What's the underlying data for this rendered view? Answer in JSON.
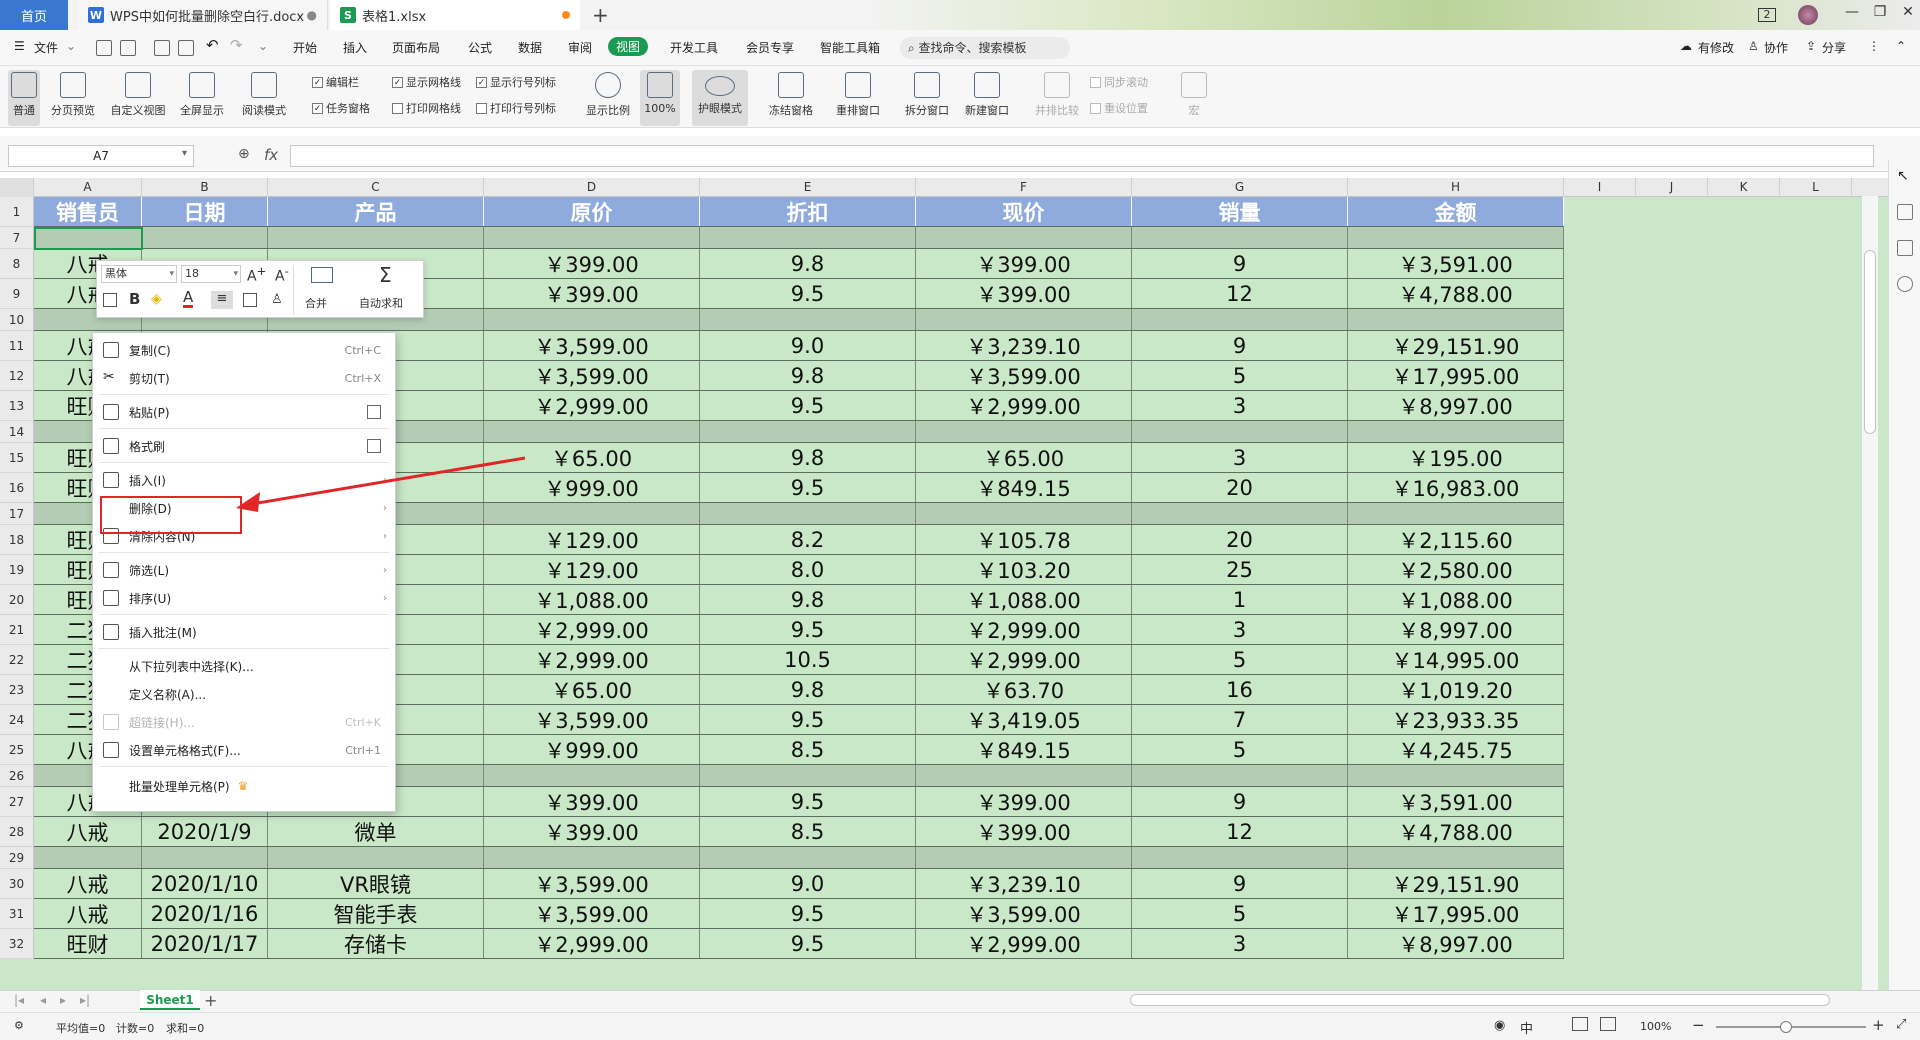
{
  "tabs": {
    "home": "首页",
    "doc": "WPS中如何批量删除空白行.docx",
    "xls": "表格1.xlsx",
    "badge": "2"
  },
  "menu": {
    "file": "文件",
    "items": [
      "开始",
      "插入",
      "页面布局",
      "公式",
      "数据",
      "审阅",
      "视图",
      "开发工具",
      "会员专享",
      "智能工具箱"
    ],
    "active": "视图",
    "search": "查找命令、搜索模板",
    "modify": "有修改",
    "collab": "协作",
    "share": "分享"
  },
  "ribbon": {
    "normal": "普通",
    "pagebreak": "分页预览",
    "custom": "自定义视图",
    "fullscreen": "全屏显示",
    "reading": "阅读模式",
    "cb_editbar": "编辑栏",
    "cb_taskpane": "任务窗格",
    "cb_showgrid": "显示网格线",
    "cb_printgrid": "打印网格线",
    "cb_showheaders": "显示行号列标",
    "cb_printheaders": "打印行号列标",
    "ratio": "显示比例",
    "p100": "100%",
    "eyecare": "护眼模式",
    "freeze": "冻结窗格",
    "rearrange": "重排窗口",
    "split": "拆分窗口",
    "newwin": "新建窗口",
    "compare": "并排比较",
    "sync": "同步滚动",
    "resetpos": "重设位置",
    "macro": "宏"
  },
  "formula": {
    "namebox": "A7",
    "fx": "fx",
    "value": ""
  },
  "columns": [
    "A",
    "B",
    "C",
    "D",
    "E",
    "F",
    "G",
    "H",
    "I",
    "J",
    "K",
    "L"
  ],
  "header_row": {
    "num": "1",
    "cells": [
      "销售员",
      "日期",
      "产品",
      "原价",
      "折扣",
      "现价",
      "销量",
      "金额"
    ]
  },
  "rows": [
    {
      "num": "7",
      "cells": [
        "",
        "",
        "",
        "",
        "",
        "",
        "",
        ""
      ],
      "empty": true
    },
    {
      "num": "8",
      "cells": [
        "八戒",
        "",
        "",
        "￥399.00",
        "9.8",
        "￥399.00",
        "9",
        "￥3,591.00"
      ]
    },
    {
      "num": "9",
      "cells": [
        "八戒",
        "",
        "",
        "￥399.00",
        "9.5",
        "￥399.00",
        "12",
        "￥4,788.00"
      ]
    },
    {
      "num": "10",
      "cells": [
        "",
        "",
        "",
        "",
        "",
        "",
        "",
        ""
      ],
      "empty": true
    },
    {
      "num": "11",
      "cells": [
        "八戒",
        "",
        "镜",
        "￥3,599.00",
        "9.0",
        "￥3,239.10",
        "9",
        "￥29,151.90"
      ]
    },
    {
      "num": "12",
      "cells": [
        "八戒",
        "",
        "表",
        "￥3,599.00",
        "9.8",
        "￥3,599.00",
        "5",
        "￥17,995.00"
      ]
    },
    {
      "num": "13",
      "cells": [
        "旺财",
        "",
        "卡",
        "￥2,999.00",
        "9.5",
        "￥2,999.00",
        "3",
        "￥8,997.00"
      ]
    },
    {
      "num": "14",
      "cells": [
        "",
        "",
        "",
        "",
        "",
        "",
        "",
        ""
      ],
      "empty": true
    },
    {
      "num": "15",
      "cells": [
        "旺财",
        "",
        "卡",
        "￥65.00",
        "9.8",
        "￥65.00",
        "3",
        "￥195.00"
      ]
    },
    {
      "num": "16",
      "cells": [
        "旺财",
        "",
        "翻译",
        "￥999.00",
        "9.5",
        "￥849.15",
        "20",
        "￥16,983.00"
      ]
    },
    {
      "num": "17",
      "cells": [
        "",
        "",
        "",
        "",
        "",
        "",
        "",
        ""
      ],
      "empty": true
    },
    {
      "num": "18",
      "cells": [
        "旺财",
        "",
        "箱",
        "￥129.00",
        "8.2",
        "￥105.78",
        "20",
        "￥2,115.60"
      ]
    },
    {
      "num": "19",
      "cells": [
        "旺财",
        "",
        "座",
        "￥129.00",
        "8.0",
        "￥103.20",
        "25",
        "￥2,580.00"
      ]
    },
    {
      "num": "20",
      "cells": [
        "旺财",
        "",
        "表",
        "￥1,088.00",
        "9.8",
        "￥1,088.00",
        "1",
        "￥1,088.00"
      ]
    },
    {
      "num": "21",
      "cells": [
        "二狗",
        "",
        "座",
        "￥2,999.00",
        "9.5",
        "￥2,999.00",
        "3",
        "￥8,997.00"
      ]
    },
    {
      "num": "22",
      "cells": [
        "二狗",
        "",
        "",
        "￥2,999.00",
        "10.5",
        "￥2,999.00",
        "5",
        "￥14,995.00"
      ]
    },
    {
      "num": "23",
      "cells": [
        "二狗",
        "",
        "箱",
        "￥65.00",
        "9.8",
        "￥63.70",
        "16",
        "￥1,019.20"
      ]
    },
    {
      "num": "24",
      "cells": [
        "二狗",
        "",
        "镜",
        "￥3,599.00",
        "9.5",
        "￥3,419.05",
        "7",
        "￥23,933.35"
      ]
    },
    {
      "num": "25",
      "cells": [
        "八戒",
        "",
        "镜",
        "￥999.00",
        "8.5",
        "￥849.15",
        "5",
        "￥4,245.75"
      ]
    },
    {
      "num": "26",
      "cells": [
        "",
        "",
        "",
        "",
        "",
        "",
        "",
        ""
      ],
      "empty": true
    },
    {
      "num": "27",
      "cells": [
        "八戒",
        "2020/1/6",
        "微单",
        "￥399.00",
        "9.5",
        "￥399.00",
        "9",
        "￥3,591.00"
      ]
    },
    {
      "num": "28",
      "cells": [
        "八戒",
        "2020/1/9",
        "微单",
        "￥399.00",
        "8.5",
        "￥399.00",
        "12",
        "￥4,788.00"
      ]
    },
    {
      "num": "29",
      "cells": [
        "",
        "",
        "",
        "",
        "",
        "",
        "",
        ""
      ],
      "empty": true
    },
    {
      "num": "30",
      "cells": [
        "八戒",
        "2020/1/10",
        "VR眼镜",
        "￥3,599.00",
        "9.0",
        "￥3,239.10",
        "9",
        "￥29,151.90"
      ]
    },
    {
      "num": "31",
      "cells": [
        "八戒",
        "2020/1/16",
        "智能手表",
        "￥3,599.00",
        "9.5",
        "￥3,599.00",
        "5",
        "￥17,995.00"
      ]
    },
    {
      "num": "32",
      "cells": [
        "旺财",
        "2020/1/17",
        "存储卡",
        "￥2,999.00",
        "9.5",
        "￥2,999.00",
        "3",
        "￥8,997.00"
      ]
    }
  ],
  "minibar": {
    "font": "黑体",
    "size": "18",
    "merge": "合并",
    "autosum": "自动求和"
  },
  "context_menu": {
    "copy": "复制(C)",
    "copy_sc": "Ctrl+C",
    "cut": "剪切(T)",
    "cut_sc": "Ctrl+X",
    "paste": "粘贴(P)",
    "format_painter": "格式刷",
    "insert": "插入(I)",
    "delete": "删除(D)",
    "clear": "清除内容(N)",
    "filter": "筛选(L)",
    "sort": "排序(U)",
    "comment": "插入批注(M)",
    "pick": "从下拉列表中选择(K)...",
    "define_name": "定义名称(A)...",
    "hyperlink": "超链接(H)...",
    "hyperlink_sc": "Ctrl+K",
    "format_cells": "设置单元格格式(F)...",
    "format_cells_sc": "Ctrl+1",
    "batch": "批量处理单元格(P)"
  },
  "sheet": {
    "tab": "Sheet1"
  },
  "status": {
    "avg": "平均值=0",
    "count": "计数=0",
    "sum": "求和=0",
    "zoom": "100%"
  },
  "colors": {
    "accent_green": "#1c9a52",
    "header_blue": "#8faadc",
    "eyecare_green": "#c9e8c7",
    "highlight_red": "#e02626"
  }
}
